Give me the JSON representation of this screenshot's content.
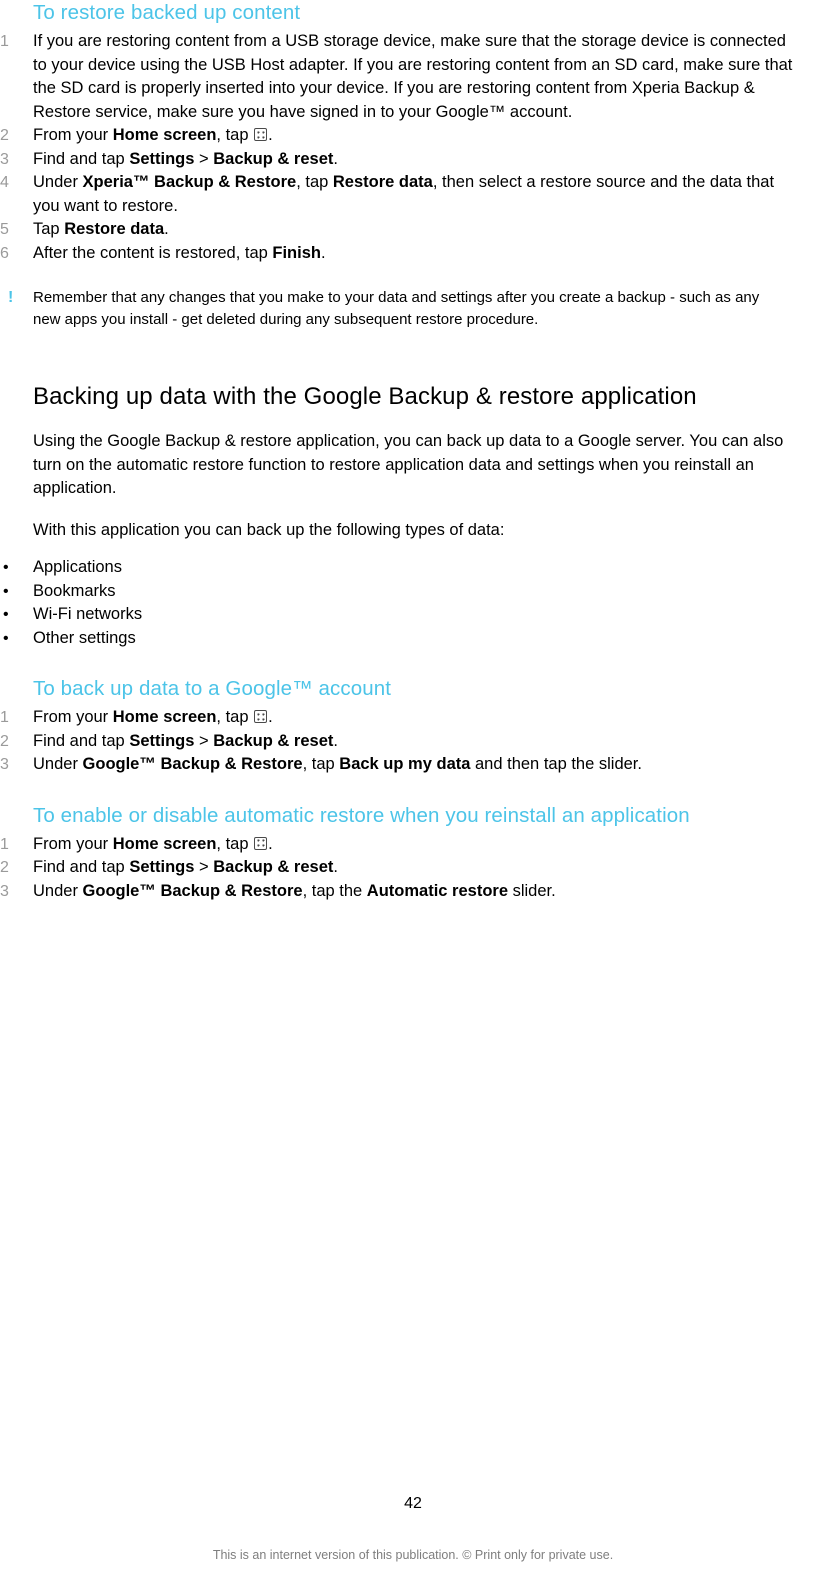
{
  "sections": {
    "restore_heading": "To restore backed up content",
    "restore_steps": [
      {
        "num": "1",
        "parts": [
          {
            "t": "If you are restoring content from a USB storage device, make sure that the storage device is connected to your device using the USB Host adapter. If you are restoring content from an SD card, make sure that the SD card is properly inserted into your device. If you are restoring content from Xperia Backup & Restore service, make sure you have signed in to your Google™ account.",
            "b": false
          }
        ]
      },
      {
        "num": "2",
        "parts": [
          {
            "t": "From your ",
            "b": false
          },
          {
            "t": "Home screen",
            "b": true
          },
          {
            "t": ", tap ",
            "b": false
          },
          {
            "t": "[appicon]",
            "b": false
          },
          {
            "t": ".",
            "b": false
          }
        ]
      },
      {
        "num": "3",
        "parts": [
          {
            "t": "Find and tap ",
            "b": false
          },
          {
            "t": "Settings",
            "b": true
          },
          {
            "t": " > ",
            "b": false
          },
          {
            "t": "Backup & reset",
            "b": true
          },
          {
            "t": ".",
            "b": false
          }
        ]
      },
      {
        "num": "4",
        "parts": [
          {
            "t": "Under ",
            "b": false
          },
          {
            "t": "Xperia™ Backup & Restore",
            "b": true
          },
          {
            "t": ", tap ",
            "b": false
          },
          {
            "t": "Restore data",
            "b": true
          },
          {
            "t": ", then select a restore source and the data that you want to restore.",
            "b": false
          }
        ]
      },
      {
        "num": "5",
        "parts": [
          {
            "t": "Tap ",
            "b": false
          },
          {
            "t": "Restore data",
            "b": true
          },
          {
            "t": ".",
            "b": false
          }
        ]
      },
      {
        "num": "6",
        "parts": [
          {
            "t": "After the content is restored, tap ",
            "b": false
          },
          {
            "t": "Finish",
            "b": true
          },
          {
            "t": ".",
            "b": false
          }
        ]
      }
    ],
    "note_marker": "!",
    "note_text": "Remember that any changes that you make to your data and settings after you create a backup - such as any new apps you install - get deleted during any subsequent restore procedure.",
    "google_heading": "Backing up data with the Google Backup & restore application",
    "google_para1": "Using the Google Backup & restore application, you can back up data to a Google server. You can also turn on the automatic restore function to restore application data and settings when you reinstall an application.",
    "google_para2": "With this application you can back up the following types of data:",
    "data_types": [
      "Applications",
      "Bookmarks",
      "Wi-Fi networks",
      "Other settings"
    ],
    "backup_heading": "To back up data to a Google™ account",
    "backup_steps": [
      {
        "num": "1",
        "parts": [
          {
            "t": "From your ",
            "b": false
          },
          {
            "t": "Home screen",
            "b": true
          },
          {
            "t": ", tap ",
            "b": false
          },
          {
            "t": "[appicon]",
            "b": false
          },
          {
            "t": ".",
            "b": false
          }
        ]
      },
      {
        "num": "2",
        "parts": [
          {
            "t": "Find and tap ",
            "b": false
          },
          {
            "t": "Settings",
            "b": true
          },
          {
            "t": " > ",
            "b": false
          },
          {
            "t": "Backup & reset",
            "b": true
          },
          {
            "t": ".",
            "b": false
          }
        ]
      },
      {
        "num": "3",
        "parts": [
          {
            "t": "Under ",
            "b": false
          },
          {
            "t": "Google™ Backup & Restore",
            "b": true
          },
          {
            "t": ", tap ",
            "b": false
          },
          {
            "t": "Back up my data",
            "b": true
          },
          {
            "t": " and then tap the slider.",
            "b": false
          }
        ]
      }
    ],
    "auto_heading": "To enable or disable automatic restore when you reinstall an application",
    "auto_steps": [
      {
        "num": "1",
        "parts": [
          {
            "t": "From your ",
            "b": false
          },
          {
            "t": "Home screen",
            "b": true
          },
          {
            "t": ", tap ",
            "b": false
          },
          {
            "t": "[appicon]",
            "b": false
          },
          {
            "t": ".",
            "b": false
          }
        ]
      },
      {
        "num": "2",
        "parts": [
          {
            "t": "Find and tap ",
            "b": false
          },
          {
            "t": "Settings",
            "b": true
          },
          {
            "t": " > ",
            "b": false
          },
          {
            "t": "Backup & reset",
            "b": true
          },
          {
            "t": ".",
            "b": false
          }
        ]
      },
      {
        "num": "3",
        "parts": [
          {
            "t": "Under ",
            "b": false
          },
          {
            "t": "Google™ Backup & Restore",
            "b": true
          },
          {
            "t": ", tap the ",
            "b": false
          },
          {
            "t": "Automatic restore",
            "b": true
          },
          {
            "t": " slider.",
            "b": false
          }
        ]
      }
    ]
  },
  "footer": {
    "page_number": "42",
    "disclaimer": "This is an internet version of this publication. © Print only for private use."
  },
  "colors": {
    "heading_accent": "#4cc4e8",
    "step_number": "#9a9a9a",
    "footer_text": "#7e7e7e"
  }
}
